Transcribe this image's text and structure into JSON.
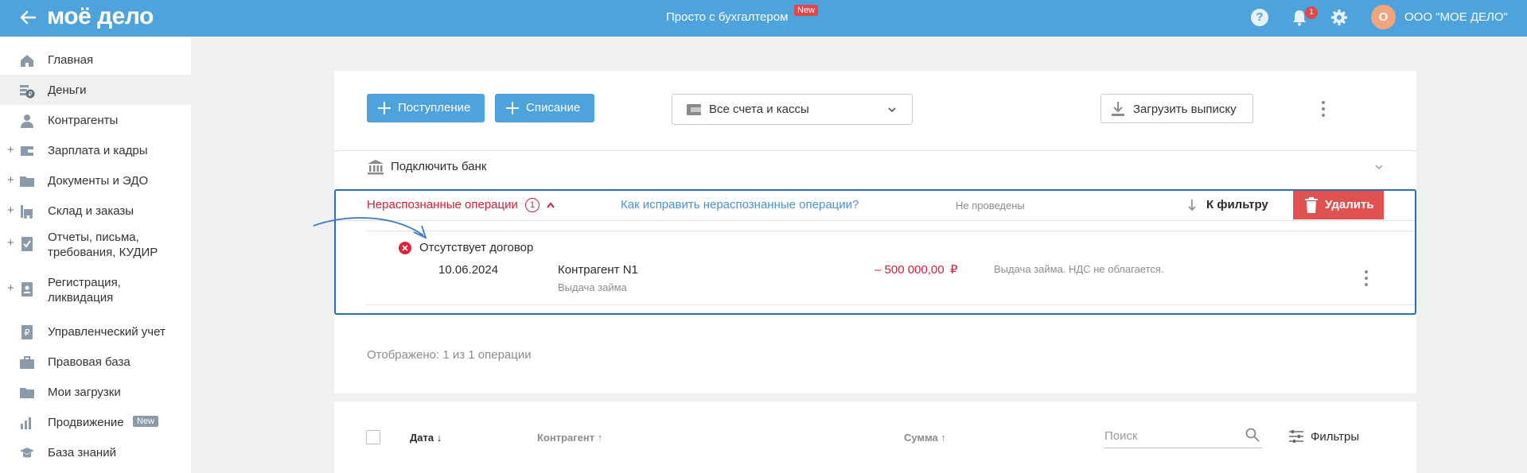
{
  "topbar": {
    "logo": "моё дело",
    "center_label": "Просто с бухгалтером",
    "new_badge": "New",
    "help": "?",
    "notifications_count": "1",
    "avatar_letter": "О",
    "org_name": "ООО \"МОЕ ДЕЛО\""
  },
  "sidebar": {
    "items": [
      {
        "label": "Главная",
        "icon": "home-icon",
        "expandable": false
      },
      {
        "label": "Деньги",
        "icon": "money-icon",
        "expandable": false,
        "active": true
      },
      {
        "label": "Контрагенты",
        "icon": "contractor-icon",
        "expandable": false
      },
      {
        "label": "Зарплата и кадры",
        "icon": "salary-icon",
        "expandable": true
      },
      {
        "label": "Документы и ЭДО",
        "icon": "folder-icon",
        "expandable": true
      },
      {
        "label": "Склад и заказы",
        "icon": "warehouse-icon",
        "expandable": true
      },
      {
        "label_line1": "Отчеты, письма,",
        "label_line2": "требования, КУДИР",
        "icon": "reports-icon",
        "expandable": true
      },
      {
        "label_line1": "Регистрация,",
        "label_line2": "ликвидация",
        "icon": "registration-icon",
        "expandable": true
      },
      {
        "label": "Управленческий учет",
        "icon": "management-icon",
        "expandable": false
      },
      {
        "label": "Правовая база",
        "icon": "briefcase-icon",
        "expandable": false
      },
      {
        "label": "Мои загрузки",
        "icon": "downloads-folder-icon",
        "expandable": false
      },
      {
        "label": "Продвижение",
        "icon": "promotion-icon",
        "expandable": false,
        "badge": "New"
      },
      {
        "label": "База знаний",
        "icon": "knowledge-icon",
        "expandable": false
      }
    ]
  },
  "toolbar": {
    "income_label": "Поступление",
    "expense_label": "Списание",
    "accounts_select": "Все счета и кассы",
    "upload_label": "Загрузить выписку"
  },
  "bank": {
    "connect_label": "Подключить банк"
  },
  "unrecognized": {
    "title": "Нераспознанные операции",
    "count": "1",
    "help_link": "Как исправить нераспознанные операции?",
    "status": "Не проведены",
    "to_filter": "К фильтру",
    "delete_label": "Удалить",
    "error_text": "Отсутствует договор",
    "operation": {
      "date": "10.06.2024",
      "contractor": "Контрагент N1",
      "purpose": "Выдача займа",
      "amount": "– 500 000,00",
      "currency": "₽",
      "description": "Выдача займа. НДС не облагается."
    },
    "shown_text": "Отображено: 1 из 1 операции"
  },
  "table": {
    "col_date": "Дата",
    "col_contractor": "Контрагент",
    "col_amount": "Сумма",
    "search_placeholder": "Поиск",
    "filters_label": "Фильтры"
  },
  "colors": {
    "topbar": "#4ea3dc",
    "primary_button": "#4ea3dc",
    "danger_button": "#e05252",
    "error_text": "#d4203a",
    "frame_highlight": "#2b6fb6"
  }
}
